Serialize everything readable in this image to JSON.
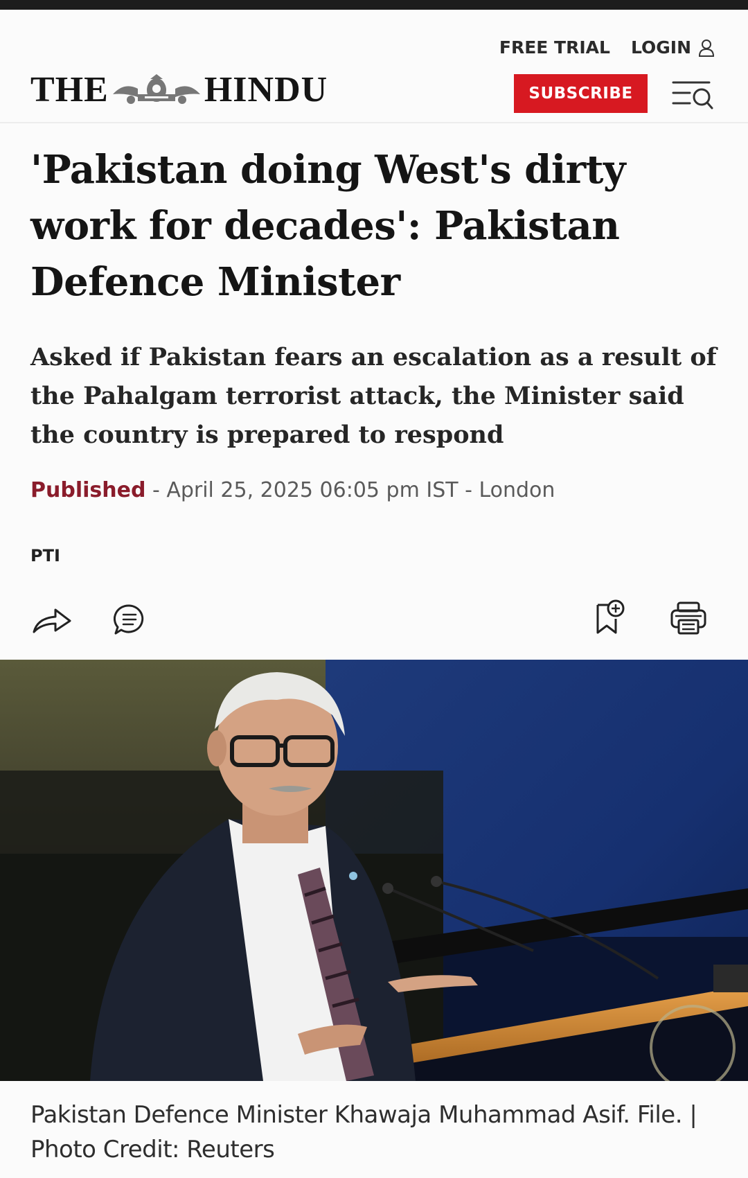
{
  "header": {
    "logo_left": "THE",
    "logo_right": "HINDU",
    "free_trial": "FREE TRIAL",
    "login": "LOGIN",
    "subscribe": "SUBSCRIBE"
  },
  "article": {
    "headline": "'Pakistan doing West's dirty work for decades': Pakistan Defence Minister",
    "standfirst": "Asked if Pakistan fears an escalation as a result of the Pahalgam terrorist attack, the Minister said the country is prepared to respond",
    "published_label": "Published",
    "published_rest": " - April 25, 2025 06:05 pm IST - London",
    "byline": "PTI",
    "caption": "Pakistan Defence Minister Khawaja Muhammad Asif. File. | Photo Credit: Reuters"
  },
  "icons": {
    "user": "user-icon",
    "menu": "menu-search-icon",
    "share": "share-icon",
    "comment": "comment-icon",
    "bookmark": "bookmark-add-icon",
    "print": "print-icon"
  },
  "colors": {
    "subscribe_bg": "#d71921",
    "published_label": "#8a1c2b",
    "top_bar": "#1d1d1d"
  }
}
